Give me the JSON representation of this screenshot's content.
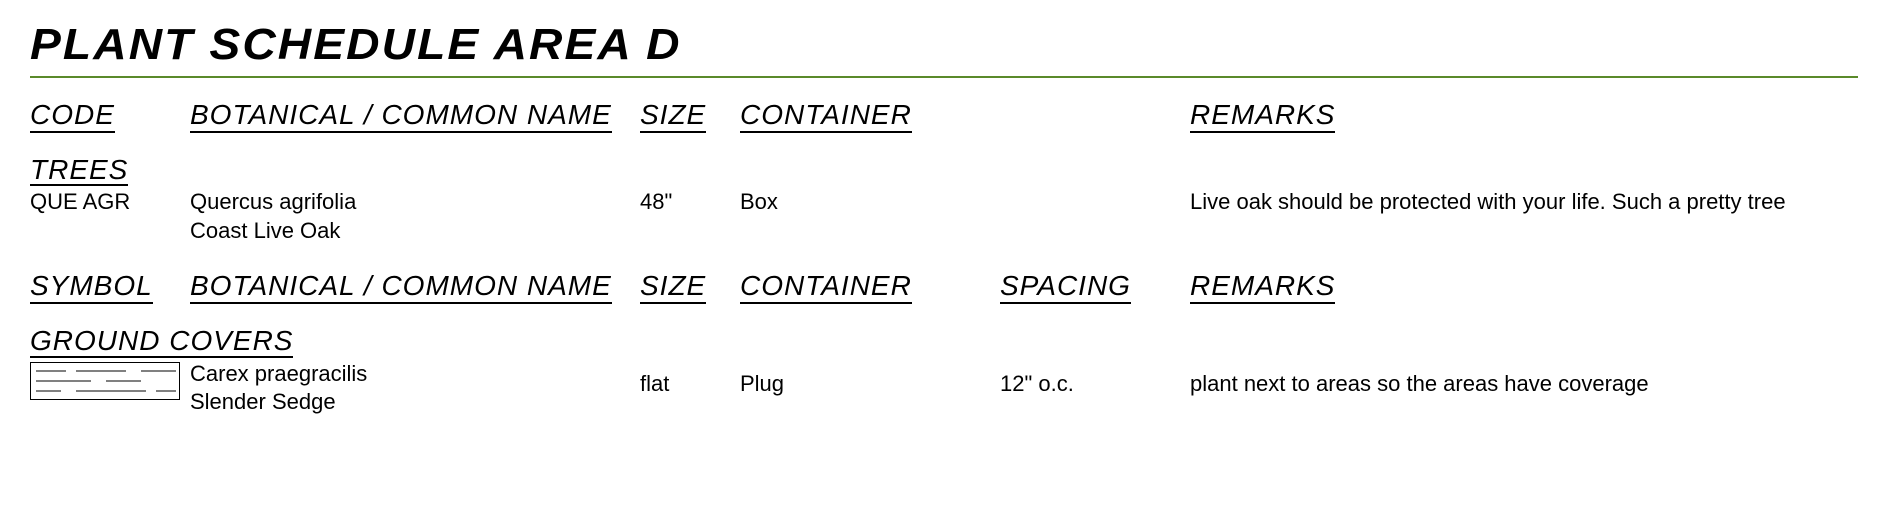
{
  "title": "PLANT SCHEDULE AREA D",
  "headers1": {
    "code": "CODE",
    "name": "BOTANICAL / COMMON NAME",
    "size": "SIZE",
    "container": "CONTAINER",
    "remarks": "REMARKS"
  },
  "section_trees": "TREES",
  "tree": {
    "code": "QUE AGR",
    "botanical": "Quercus agrifolia",
    "common": "Coast Live Oak",
    "size": "48\"",
    "container": "Box",
    "remarks": "Live oak should be protected with your life. Such a pretty tree"
  },
  "headers2": {
    "symbol": "SYMBOL",
    "name": "BOTANICAL / COMMON NAME",
    "size": "SIZE",
    "container": "CONTAINER",
    "spacing": "SPACING",
    "remarks": "REMARKS"
  },
  "section_ground": "GROUND COVERS",
  "ground": {
    "botanical": "Carex praegracilis",
    "common": "Slender Sedge",
    "size": "flat",
    "container": "Plug",
    "spacing": "12\" o.c.",
    "remarks": "plant next to areas so the areas have coverage"
  }
}
